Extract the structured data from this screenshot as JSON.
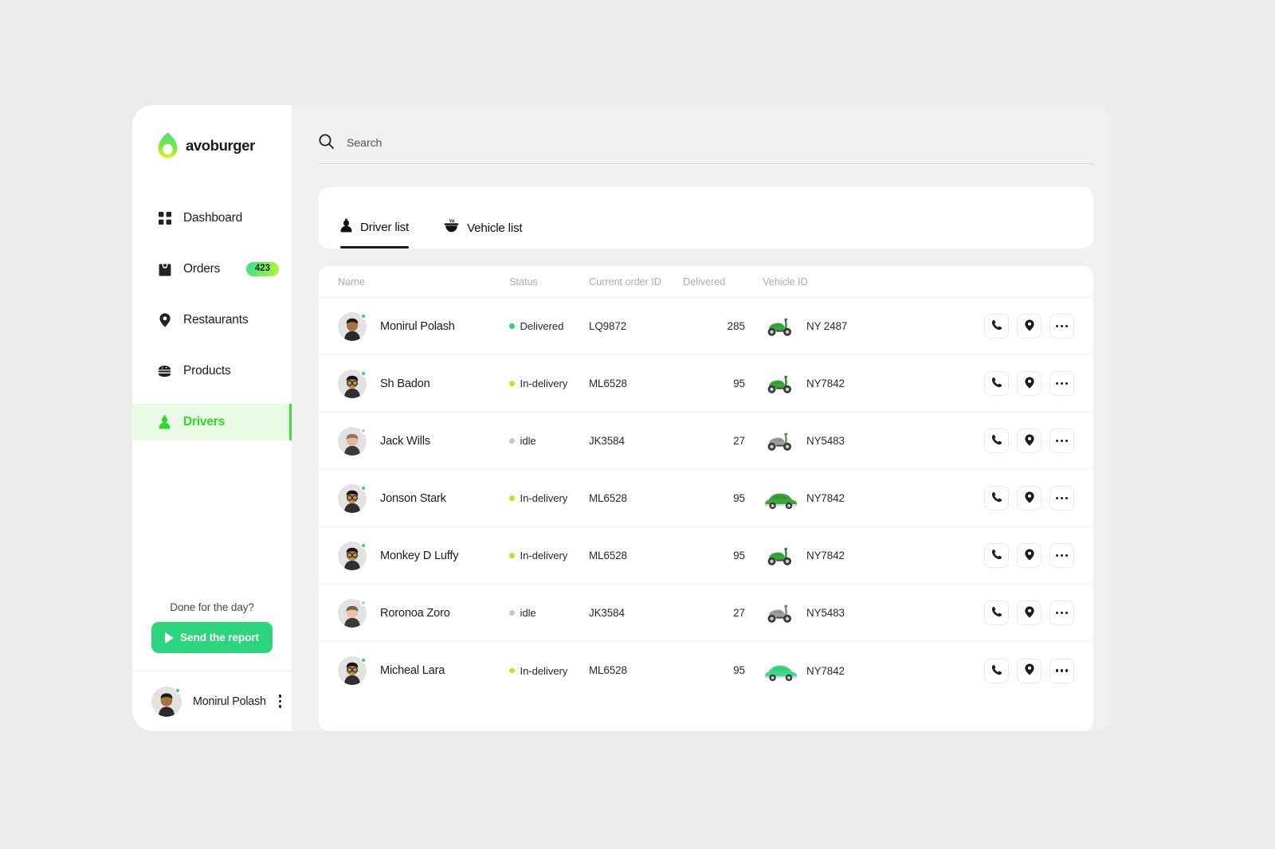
{
  "brand": {
    "name": "avoburger",
    "logo_icon": "avocado-logo"
  },
  "sidebar": {
    "items": [
      {
        "label": "Dashboard",
        "icon": "grid-icon",
        "badge": null,
        "active": false
      },
      {
        "label": "Orders",
        "icon": "shopping-bag-icon",
        "badge": "423",
        "active": false
      },
      {
        "label": "Restaurants",
        "icon": "location-pin-icon",
        "badge": null,
        "active": false
      },
      {
        "label": "Products",
        "icon": "burger-icon",
        "badge": null,
        "active": false
      },
      {
        "label": "Drivers",
        "icon": "driver-icon",
        "badge": null,
        "active": true
      }
    ],
    "report": {
      "prompt": "Done for the day?",
      "button_label": "Send the report",
      "button_icon": "play-icon",
      "button_color": "#2bd47d"
    },
    "user": {
      "name": "Monirul Polash",
      "status": "online",
      "menu_icon": "kebab-vertical-icon"
    }
  },
  "search": {
    "placeholder": "Search",
    "value": "",
    "icon": "search-icon"
  },
  "tabs": [
    {
      "label": "Driver list",
      "icon": "driver-icon",
      "active": true
    },
    {
      "label": "Vehicle list",
      "icon": "bowl-icon",
      "active": false
    }
  ],
  "table": {
    "columns": [
      "Name",
      "Status",
      "Current order ID",
      "Delivered",
      "Vehicle ID"
    ],
    "row_actions": [
      {
        "icon": "phone-icon",
        "name": "call-button"
      },
      {
        "icon": "location-pin-icon",
        "name": "locate-button"
      },
      {
        "icon": "kebab-horizontal-icon",
        "name": "more-button"
      }
    ],
    "rows": [
      {
        "name": "Monirul Polash",
        "presence": "online",
        "status": "Delivered",
        "status_color": "#2ed47a",
        "order_id": "LQ9872",
        "delivered": "285",
        "vehicle_id": "NY 2487",
        "vehicle": "scooter-green"
      },
      {
        "name": "Sh Badon",
        "presence": "online",
        "status": "In-delivery",
        "status_color": "#c8e022",
        "order_id": "ML6528",
        "delivered": "95",
        "vehicle_id": "NY7842",
        "vehicle": "scooter-green"
      },
      {
        "name": "Jack Wills",
        "presence": "offline",
        "status": "idle",
        "status_color": "#c9c9c9",
        "order_id": "JK3584",
        "delivered": "27",
        "vehicle_id": "NY5483",
        "vehicle": "scooter-gray"
      },
      {
        "name": "Jonson Stark",
        "presence": "online",
        "status": "In-delivery",
        "status_color": "#c8e022",
        "order_id": "ML6528",
        "delivered": "95",
        "vehicle_id": "NY7842",
        "vehicle": "car-green"
      },
      {
        "name": "Monkey D Luffy",
        "presence": "online",
        "status": "In-delivery",
        "status_color": "#c8e022",
        "order_id": "ML6528",
        "delivered": "95",
        "vehicle_id": "NY7842",
        "vehicle": "scooter-green"
      },
      {
        "name": "Roronoa Zoro",
        "presence": "offline",
        "status": "idle",
        "status_color": "#c9c9c9",
        "order_id": "JK3584",
        "delivered": "27",
        "vehicle_id": "NY5483",
        "vehicle": "scooter-gray"
      },
      {
        "name": "Micheal Lara",
        "presence": "online",
        "status": "In-delivery",
        "status_color": "#c8e022",
        "order_id": "ML6528",
        "delivered": "95",
        "vehicle_id": "NY7842",
        "vehicle": "car-mint"
      }
    ]
  },
  "colors": {
    "accent_green": "#2ed62e",
    "active_nav_bg": "#e9fbe5",
    "button_green": "#2bd47d",
    "page_bg": "#ebebeb",
    "card_bg": "#ffffff"
  }
}
